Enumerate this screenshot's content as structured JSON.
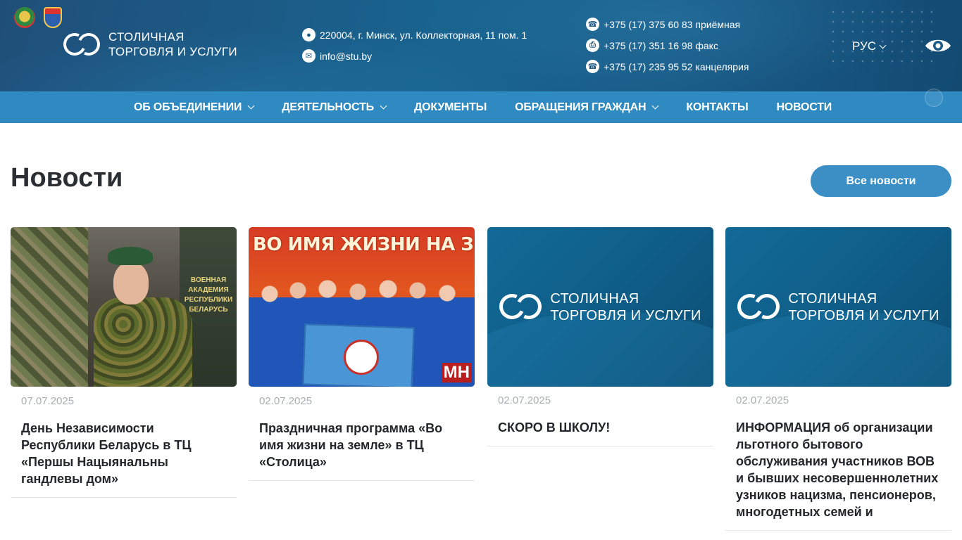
{
  "header": {
    "logo_line1": "СТОЛИЧНАЯ",
    "logo_line2": "ТОРГОВЛЯ И УСЛУГИ",
    "address": "220004, г. Минск, ул. Коллекторная, 11 пом. 1",
    "email": "info@stu.by",
    "phones": [
      {
        "text": "+375 (17) 375 60 83 приёмная",
        "icon": "phone-icon"
      },
      {
        "text": "+375 (17) 351 16 98 факс",
        "icon": "fax-icon"
      },
      {
        "text": "+375 (17) 235 95 52 канцелярия",
        "icon": "phone-icon"
      }
    ],
    "language": "РУС",
    "accessibility_icon": "eye-icon",
    "icons": {
      "address": "location-pin-icon",
      "email": "envelope-icon"
    }
  },
  "nav": {
    "items": [
      {
        "label": "ОБ ОБЪЕДИНЕНИИ",
        "has_dropdown": true
      },
      {
        "label": "ДЕЯТЕЛЬНОСТЬ",
        "has_dropdown": true
      },
      {
        "label": "ДОКУМЕНТЫ",
        "has_dropdown": false
      },
      {
        "label": "ОБРАЩЕНИЯ ГРАЖДАН",
        "has_dropdown": true
      },
      {
        "label": "КОНТАКТЫ",
        "has_dropdown": false
      },
      {
        "label": "НОВОСТИ",
        "has_dropdown": false
      }
    ]
  },
  "news": {
    "title": "Новости",
    "all_news_label": "Все новости",
    "cards": [
      {
        "date": "07.07.2025",
        "title": "День Независимости Республики Беларусь в ТЦ «Першы Нацыянальны гандлевы дом»",
        "image": "soldier-child-photo"
      },
      {
        "date": "02.07.2025",
        "title": "Праздничная программа «Во имя жизни на земле» в ТЦ «Столица»",
        "image": "women-group-photo",
        "image_text": {
          "banner": "ВО ИМЯ ЖИЗНИ НА ЗЕМ",
          "badge": "МН"
        }
      },
      {
        "date": "02.07.2025",
        "title": "СКОРО В ШКОЛУ!",
        "image": "company-logo-tile",
        "image_text": {
          "line1": "СТОЛИЧНАЯ",
          "line2": "ТОРГОВЛЯ И УСЛУГИ"
        }
      },
      {
        "date": "02.07.2025",
        "title": "ИНФОРМАЦИЯ об организации льготного бытового обслуживания участников ВОВ и бывших несовершеннолетних узников нацизма, пенсионеров, многодетных семей и",
        "image": "company-logo-tile",
        "image_text": {
          "line1": "СТОЛИЧНАЯ",
          "line2": "ТОРГОВЛЯ И УСЛУГИ"
        }
      }
    ]
  },
  "colors": {
    "header_bg": "#1a5c88",
    "nav_bg": "#2f8ac2",
    "button_bg": "#3b8fc4",
    "date_text": "#a8adb2"
  }
}
